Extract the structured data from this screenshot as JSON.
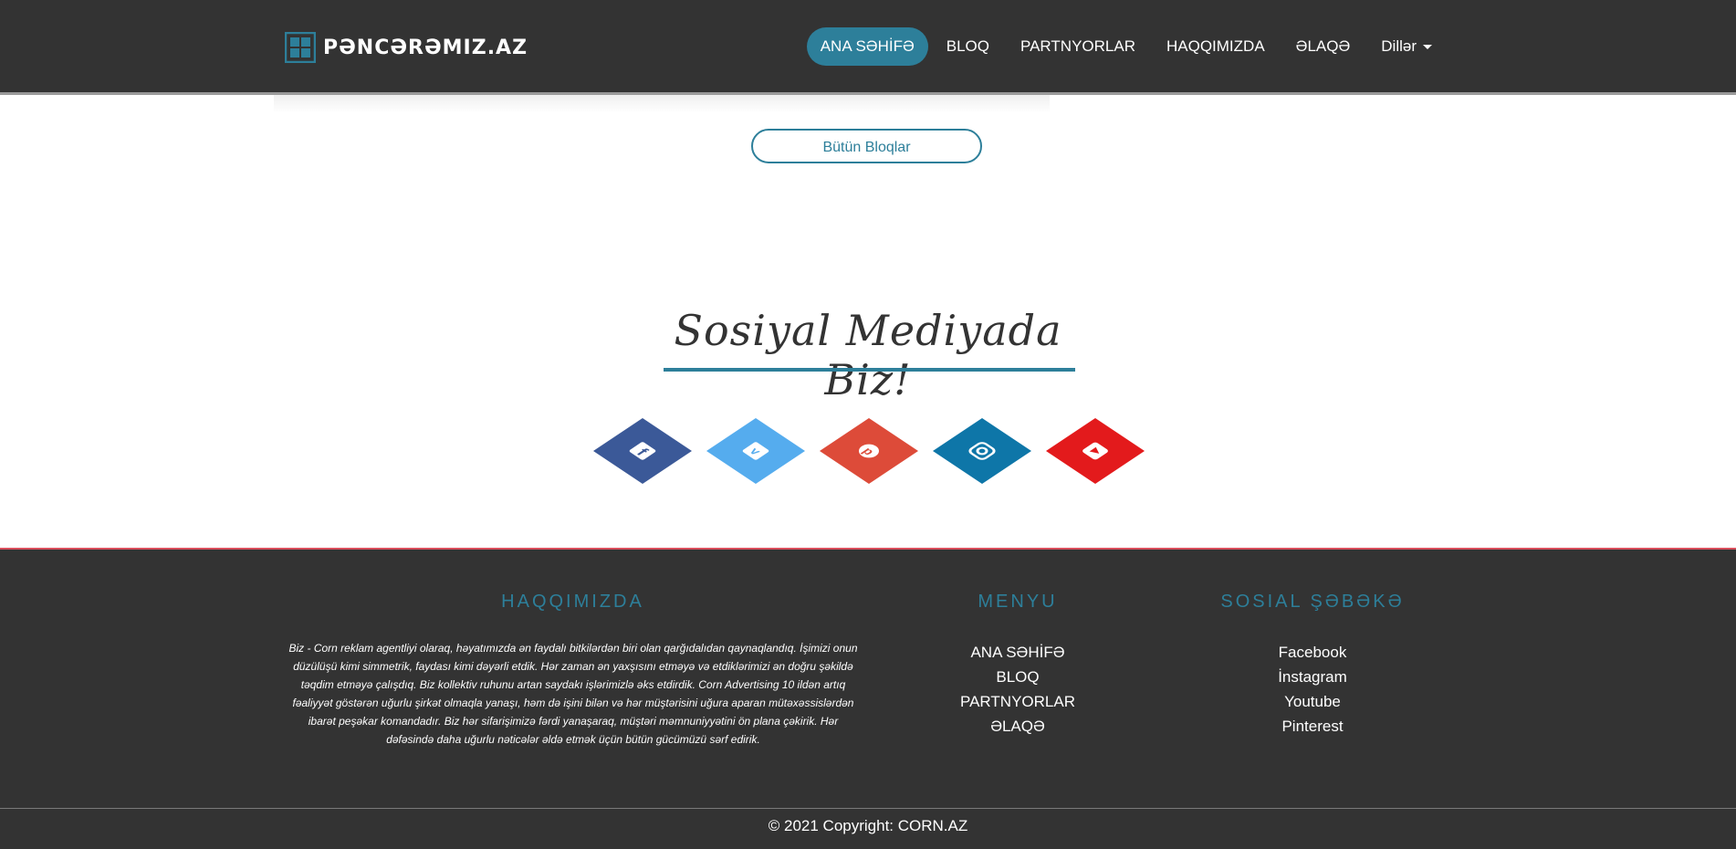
{
  "header": {
    "logo_text": "PƏNCƏRƏMIZ.AZ",
    "logo_icon": "window-logo-icon",
    "nav": [
      {
        "label": "ANA SƏHİFƏ",
        "active": true
      },
      {
        "label": "BLOQ",
        "active": false
      },
      {
        "label": "PARTNYORLAR",
        "active": false
      },
      {
        "label": "HAQQIMIZDA",
        "active": false
      },
      {
        "label": "ƏLAQƏ",
        "active": false
      },
      {
        "label": "Dillər",
        "active": false
      }
    ]
  },
  "blogs": {
    "all_button": "Bütün Bloqlar"
  },
  "social_section": {
    "heading": "Sosiyal Mediyada Biz!",
    "icons": [
      {
        "name": "facebook-icon",
        "color": "#3b5998"
      },
      {
        "name": "vimeo-icon",
        "color": "#55acee"
      },
      {
        "name": "pinterest-icon",
        "color": "#dd4b39"
      },
      {
        "name": "instagram-icon",
        "color": "#0e76a8"
      },
      {
        "name": "youtube-icon",
        "color": "#e31a1c"
      }
    ]
  },
  "footer": {
    "about_title": "HAQQIMIZDA",
    "about_text": "Biz - Corn reklam agentliyi olaraq, həyatımızda ən faydalı bitkilərdən biri olan qarğıdalıdan qaynaqlandıq. İşimizi onun düzülüşü kimi simmetrik, faydası kimi dəyərli etdik. Hər zaman ən yaxşısını etməyə və etdiklərimizi ən doğru şəkildə təqdim etməyə çalışdıq. Biz kollektiv ruhunu artan saydakı işlərimizlə əks etdirdik. Corn Advertising 10 ildən artıq fəaliyyət göstərən uğurlu şirkət olmaqla yanaşı, həm də işini bilən və hər müştərisini uğura aparan mütəxəssislərdən ibarət peşəkar komandadır. Biz hər sifarişimizə fərdi yanaşaraq, müştəri məmnuniyyətini ön plana çəkirik. Hər dəfəsində daha uğurlu nəticələr əldə etmək üçün bütün gücümüzü sərf edirik.",
    "menu_title": "MENYU",
    "menu": [
      "ANA SƏHİFƏ",
      "BLOQ",
      "PARTNYORLAR",
      "ƏLAQƏ"
    ],
    "social_title": "SOSIAL ŞƏBƏKƏ",
    "social": [
      "Facebook",
      "İnstagram",
      "Youtube",
      "Pinterest"
    ],
    "copyright": "© 2021 Copyright: CORN.AZ"
  }
}
